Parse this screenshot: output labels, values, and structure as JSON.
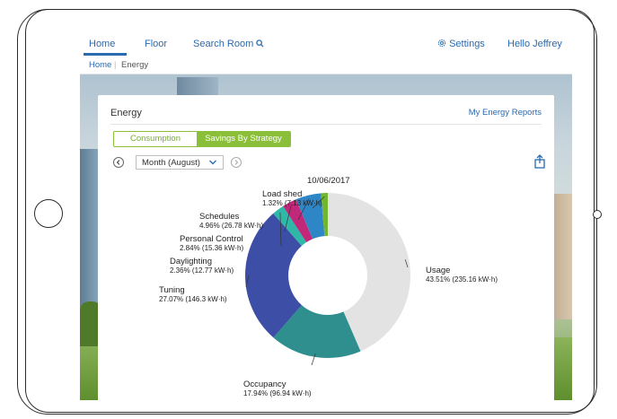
{
  "nav": {
    "items": [
      {
        "label": "Home"
      },
      {
        "label": "Floor"
      },
      {
        "label": "Search Room"
      }
    ],
    "settings": "Settings",
    "user": "Hello Jeffrey"
  },
  "breadcrumb": [
    "Home",
    "Energy"
  ],
  "card": {
    "title": "Energy",
    "reports_link": "My Energy Reports",
    "tabs": [
      "Consumption",
      "Savings By Strategy"
    ],
    "active_tab": "Savings By Strategy",
    "period": "Month (August)"
  },
  "chart_data": {
    "type": "pie",
    "title": "10/06/2017",
    "slices": [
      {
        "name": "Usage",
        "percent": 43.51,
        "value": "235.16 kW·h",
        "pct_label": "43.51% (235.16 kW·h)",
        "color": "#e3e3e3"
      },
      {
        "name": "Occupancy",
        "percent": 17.94,
        "value": "96.94 kW·h",
        "pct_label": "17.94% (96.94 kW·h)",
        "color": "#2f8f8f"
      },
      {
        "name": "Tuning",
        "percent": 27.07,
        "value": "146.3 kW·h",
        "pct_label": "27.07% (146.3 kW·h)",
        "color": "#3d4ea6"
      },
      {
        "name": "Daylighting",
        "percent": 2.36,
        "value": "12.77 kW·h",
        "pct_label": "2.36% (12.77 kW·h)",
        "color": "#2fb8a8"
      },
      {
        "name": "Personal Control",
        "percent": 2.84,
        "value": "15.36 kW·h",
        "pct_label": "2.84% (15.36 kW·h)",
        "color": "#c2287a"
      },
      {
        "name": "Schedules",
        "percent": 4.96,
        "value": "26.78 kW·h",
        "pct_label": "4.96% (26.78 kW·h)",
        "color": "#2f86c6"
      },
      {
        "name": "Load shed",
        "percent": 1.32,
        "value": "7.13 kW·h",
        "pct_label": "1.32% (7.13 kW·h)",
        "color": "#72b52e"
      }
    ]
  }
}
